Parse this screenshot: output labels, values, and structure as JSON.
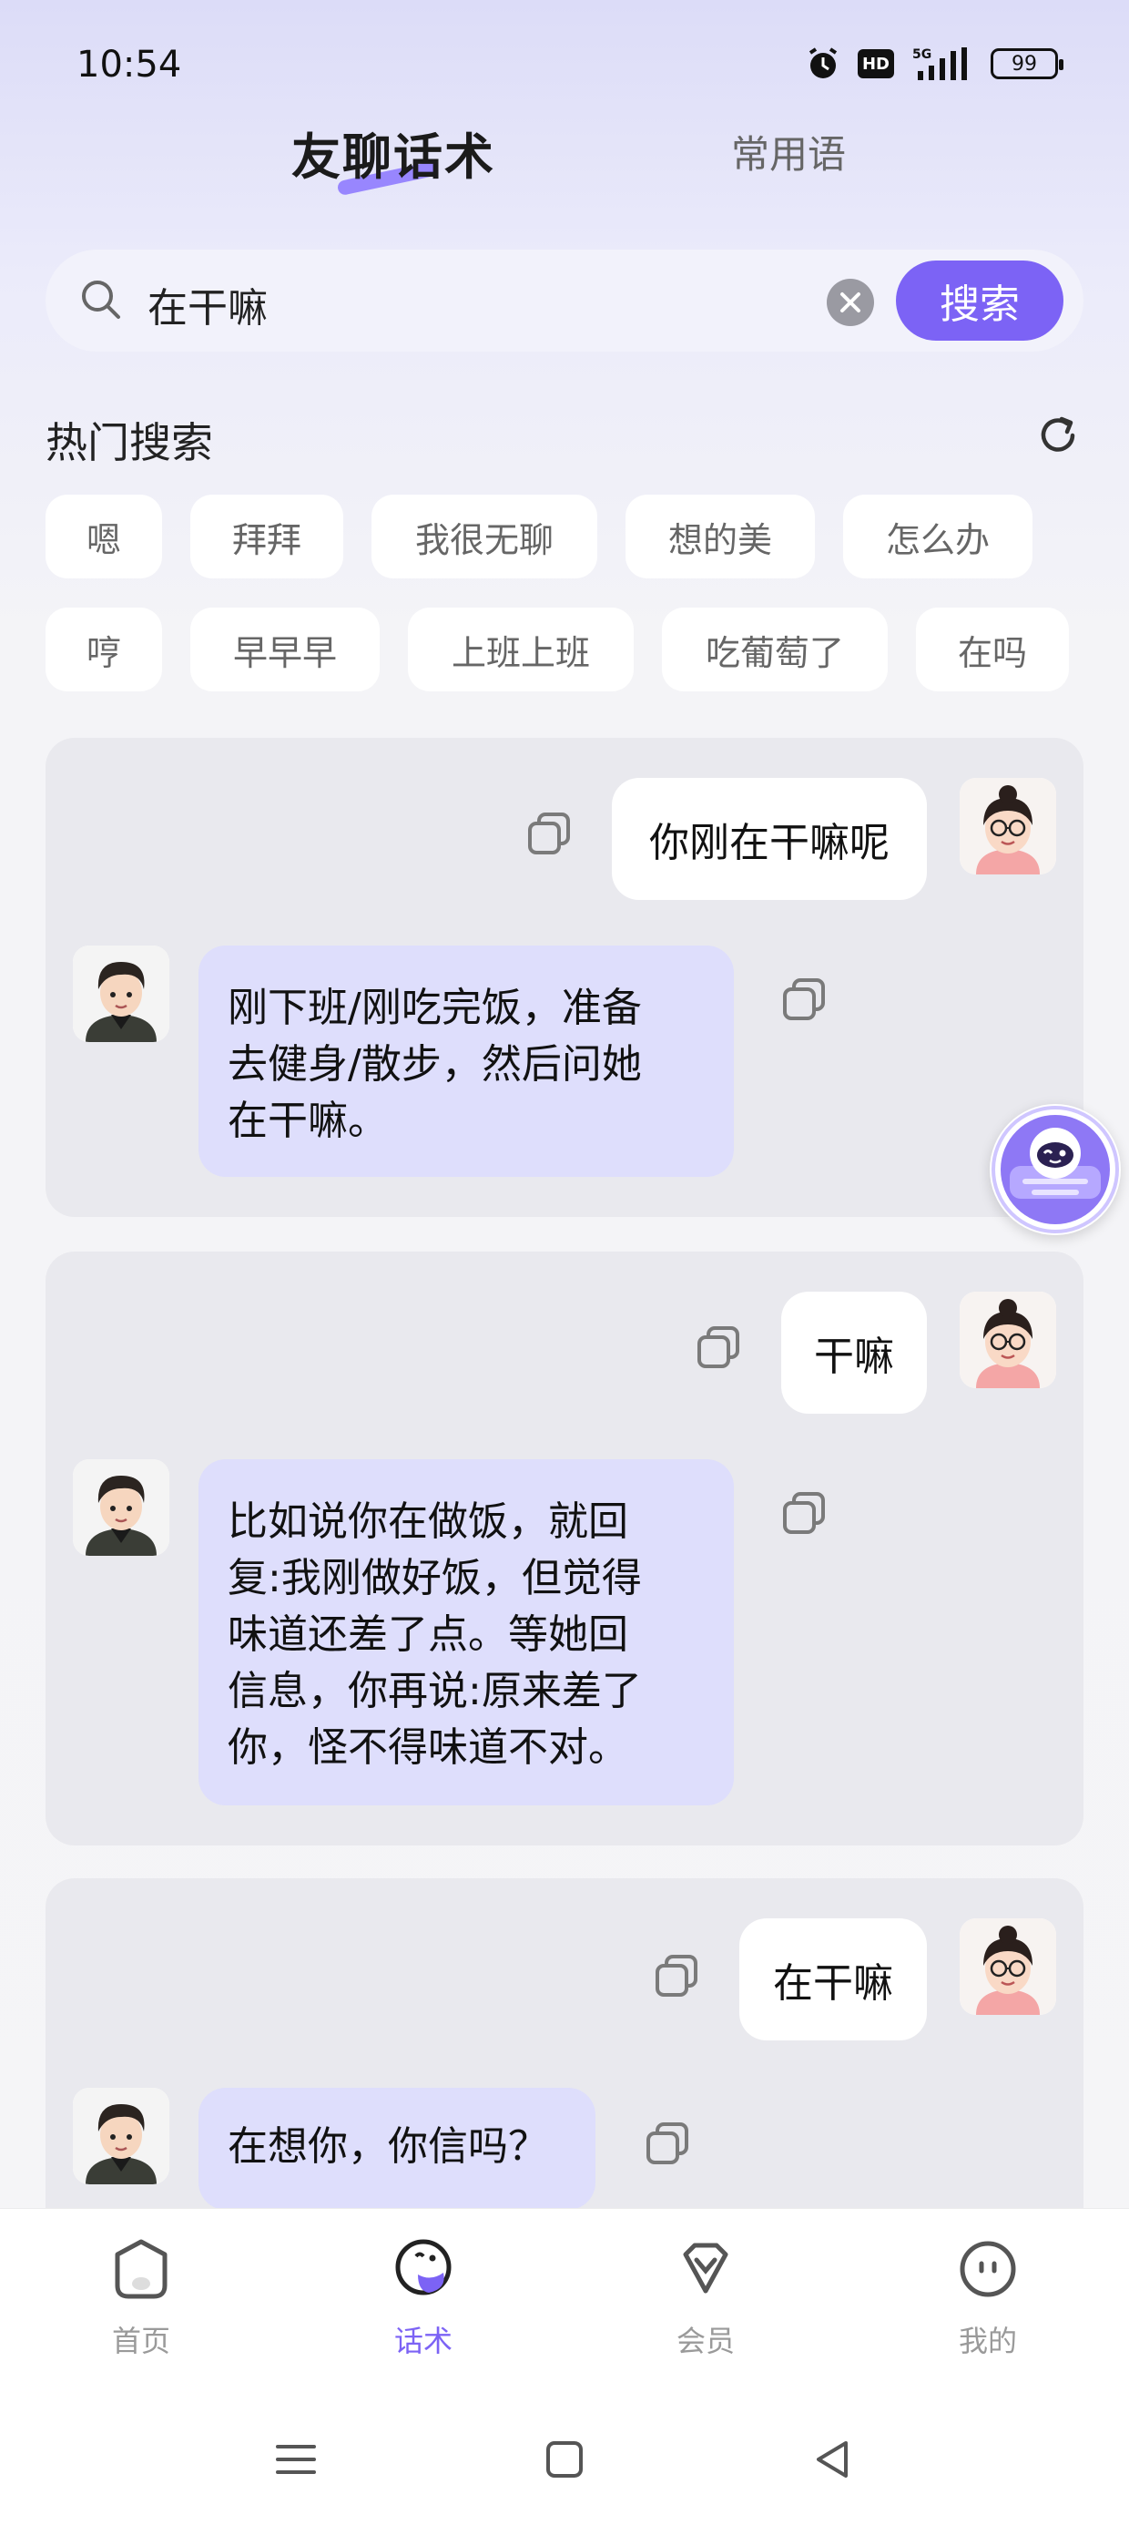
{
  "status_bar": {
    "time": "10:54",
    "hd": "HD",
    "network": "5G",
    "battery": "99"
  },
  "tabs": {
    "active": "友聊话术",
    "inactive": "常用语"
  },
  "search": {
    "value": "在干嘛",
    "button": "搜索"
  },
  "hot_search": {
    "title": "热门搜索",
    "row1": [
      "嗯",
      "拜拜",
      "我很无聊",
      "想的美",
      "怎么办"
    ],
    "row2": [
      "哼",
      "早早早",
      "上班上班",
      "吃葡萄了",
      "在吗"
    ]
  },
  "conversations": [
    {
      "question": "你刚在干嘛呢",
      "answer_lines": [
        "刚下班/刚吃完饭，准备",
        "去健身/散步，然后问她",
        "在干嘛。"
      ]
    },
    {
      "question": "干嘛",
      "answer_lines": [
        "比如说你在做饭，就回",
        "复:我刚做好饭，但觉得",
        "味道还差了点。等她回",
        "信息，你再说:原来差了",
        "你，怪不得味道不对。"
      ]
    },
    {
      "question": "在干嘛",
      "answer_lines": [
        "在想你，你信吗？"
      ]
    }
  ],
  "bottom_nav": [
    {
      "label": "首页",
      "icon": "home-icon"
    },
    {
      "label": "话术",
      "icon": "chat-face-icon",
      "active": true
    },
    {
      "label": "会员",
      "icon": "diamond-icon"
    },
    {
      "label": "我的",
      "icon": "profile-face-icon"
    }
  ],
  "colors": {
    "accent": "#7c63f5",
    "answer_bubble": "#dedefc",
    "card_bg": "#e9e9ee"
  }
}
